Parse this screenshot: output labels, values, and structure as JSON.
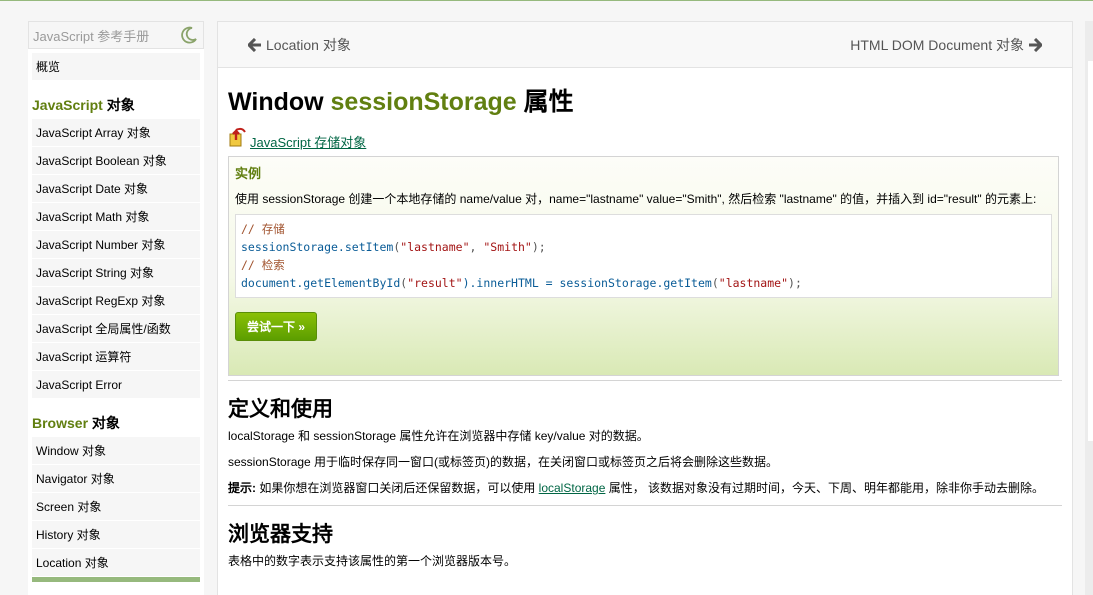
{
  "sidebar": {
    "search_placeholder": "JavaScript 参考手册",
    "overview": "概览",
    "section1": {
      "green": "JavaScript",
      "rest": " 对象"
    },
    "items1": [
      "JavaScript Array 对象",
      "JavaScript Boolean 对象",
      "JavaScript Date 对象",
      "JavaScript Math 对象",
      "JavaScript Number 对象",
      "JavaScript String 对象",
      "JavaScript RegExp 对象",
      "JavaScript 全局属性/函数",
      "JavaScript 运算符",
      "JavaScript Error"
    ],
    "section2": {
      "green": "Browser",
      "rest": " 对象"
    },
    "items2": [
      "Window 对象",
      "Navigator 对象",
      "Screen 对象",
      "History 对象",
      "Location 对象"
    ]
  },
  "nav": {
    "prev": "Location 对象",
    "next": "HTML DOM Document 对象"
  },
  "title": {
    "pre": "Window ",
    "green": "sessionStorage",
    "post": " 属性"
  },
  "crumb": " JavaScript 存储对象",
  "example": {
    "heading": "实例",
    "desc": "使用 sessionStorage 创建一个本地存储的 name/value 对，name=\"lastname\" value=\"Smith\", 然后检索 \"lastname\" 的值，并插入到 id=\"result\" 的元素上:",
    "code": {
      "c1": "// 存储",
      "l2a": "sessionStorage.setItem",
      "l2b": "(",
      "l2c": "\"lastname\"",
      "l2d": ", ",
      "l2e": "\"Smith\"",
      "l2f": ");",
      "c3": "// 检索",
      "l4a": "document.getElementById",
      "l4b": "(",
      "l4c": "\"result\"",
      "l4d": ").innerHTML = sessionStorage.getItem",
      "l4e": "(",
      "l4f": "\"lastname\"",
      "l4g": ");"
    },
    "try_label": "尝试一下 »"
  },
  "section_def": {
    "heading": "定义和使用",
    "p1": "localStorage 和 sessionStorage 属性允许在浏览器中存储 key/value 对的数据。",
    "p2": "sessionStorage 用于临时保存同一窗口(或标签页)的数据，在关闭窗口或标签页之后将会删除这些数据。",
    "tip_label": "提示:",
    "tip_a": " 如果你想在浏览器窗口关闭后还保留数据，可以使用 ",
    "tip_link": "localStorage",
    "tip_b": " 属性， 该数据对象没有过期时间，今天、下周、明年都能用，除非你手动去删除。"
  },
  "section_support": {
    "heading": "浏览器支持",
    "p1": "表格中的数字表示支持该属性的第一个浏览器版本号。"
  }
}
